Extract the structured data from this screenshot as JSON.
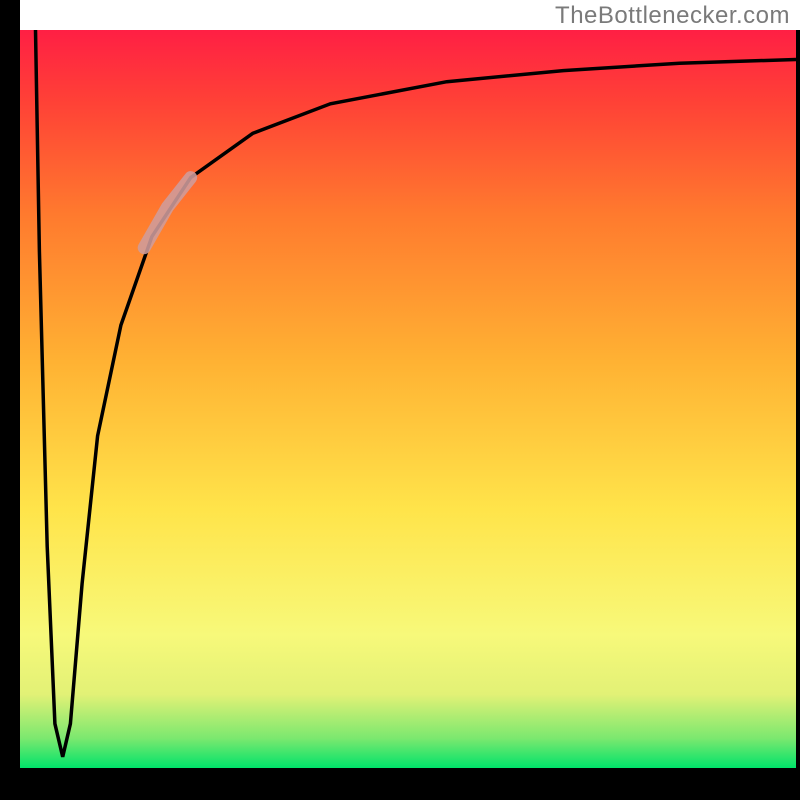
{
  "watermark": "TheBottlenecker.com",
  "chart_data": {
    "type": "line",
    "title": "",
    "xlabel": "",
    "ylabel": "",
    "xlim": [
      0,
      100
    ],
    "ylim": [
      0,
      100
    ],
    "background_gradient": {
      "bottom_color": "#00e36a",
      "mid_low_color": "#f7f97a",
      "mid_color": "#ffcc33",
      "mid_high_color": "#ff8a2a",
      "top_color": "#ff1f44"
    },
    "series": [
      {
        "name": "bottleneck-curve",
        "color": "#000000",
        "points": [
          {
            "x": 2.0,
            "y": 100.0
          },
          {
            "x": 2.5,
            "y": 70.0
          },
          {
            "x": 3.5,
            "y": 30.0
          },
          {
            "x": 4.5,
            "y": 6.0
          },
          {
            "x": 5.5,
            "y": 1.5
          },
          {
            "x": 6.5,
            "y": 6.0
          },
          {
            "x": 8.0,
            "y": 25.0
          },
          {
            "x": 10.0,
            "y": 45.0
          },
          {
            "x": 13.0,
            "y": 60.0
          },
          {
            "x": 17.0,
            "y": 72.0
          },
          {
            "x": 22.0,
            "y": 80.0
          },
          {
            "x": 30.0,
            "y": 86.0
          },
          {
            "x": 40.0,
            "y": 90.0
          },
          {
            "x": 55.0,
            "y": 93.0
          },
          {
            "x": 70.0,
            "y": 94.5
          },
          {
            "x": 85.0,
            "y": 95.5
          },
          {
            "x": 100.0,
            "y": 96.0
          }
        ]
      },
      {
        "name": "highlight-segment",
        "color": "#d49a9a",
        "x_range": [
          16,
          22
        ],
        "points": [
          {
            "x": 16.0,
            "y": 70.5
          },
          {
            "x": 19.0,
            "y": 76.0
          },
          {
            "x": 22.0,
            "y": 80.0
          }
        ]
      }
    ],
    "axis_frame": {
      "left_margin_pct": 2.5,
      "right_margin_pct": 0.5,
      "top_margin_pct": 3.8,
      "bottom_margin_pct": 4.0
    }
  }
}
